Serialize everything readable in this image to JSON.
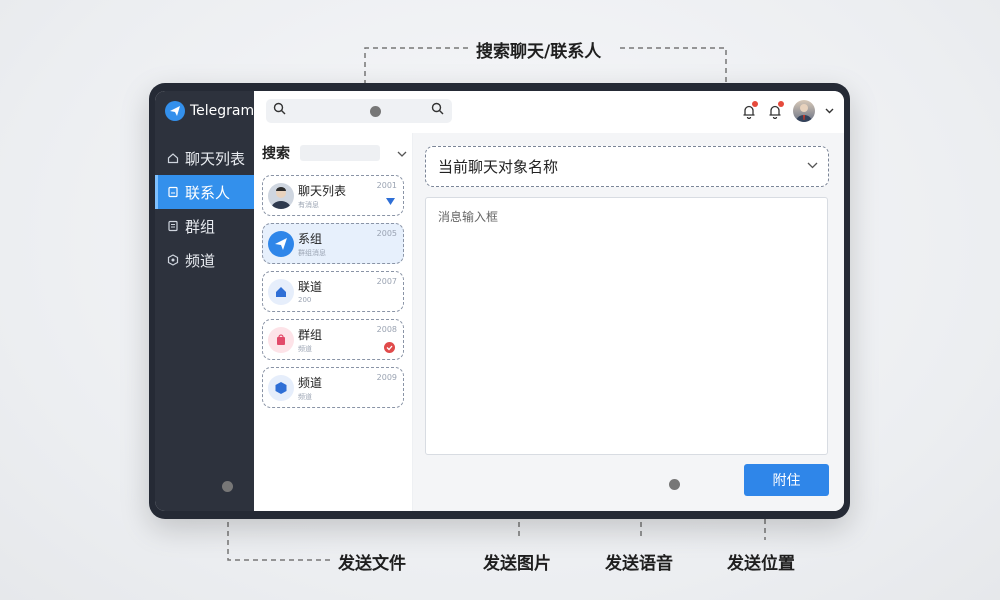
{
  "annotations": {
    "search": "搜索聊天/联系人",
    "send_file": "发送文件",
    "send_image": "发送图片",
    "send_voice": "发送语音",
    "send_location": "发送位置"
  },
  "app": {
    "name": "Telegram",
    "logo_icon": "paper-plane-icon",
    "accent_color": "#3390ec"
  },
  "sidebar": {
    "items": [
      {
        "label": "聊天列表",
        "icon": "home-icon",
        "active": false
      },
      {
        "label": "联系人",
        "icon": "contact-card-icon",
        "active": true
      },
      {
        "label": "群组",
        "icon": "document-icon",
        "active": false
      },
      {
        "label": "频道",
        "icon": "hexagon-icon",
        "active": false
      }
    ]
  },
  "topbar": {
    "search_icon": "search-icon",
    "notifications": [
      "bell-icon",
      "bell-icon"
    ],
    "avatar": "user-avatar",
    "menu_icon": "chevron-down-icon"
  },
  "list": {
    "header_label": "搜索",
    "items": [
      {
        "title": "聊天列表",
        "sub": "有消息",
        "time": "2001"
      },
      {
        "title": "系组",
        "sub": "群组消息",
        "time": "2005"
      },
      {
        "title": "联道",
        "sub": "200",
        "time": "2007"
      },
      {
        "title": "群组",
        "sub": "频道",
        "time": "2008"
      },
      {
        "title": "频道",
        "sub": "频道",
        "time": "2009"
      }
    ]
  },
  "conversation": {
    "title": "当前聊天对象名称",
    "message_placeholder": "消息输入框",
    "attach_button": "附住"
  }
}
